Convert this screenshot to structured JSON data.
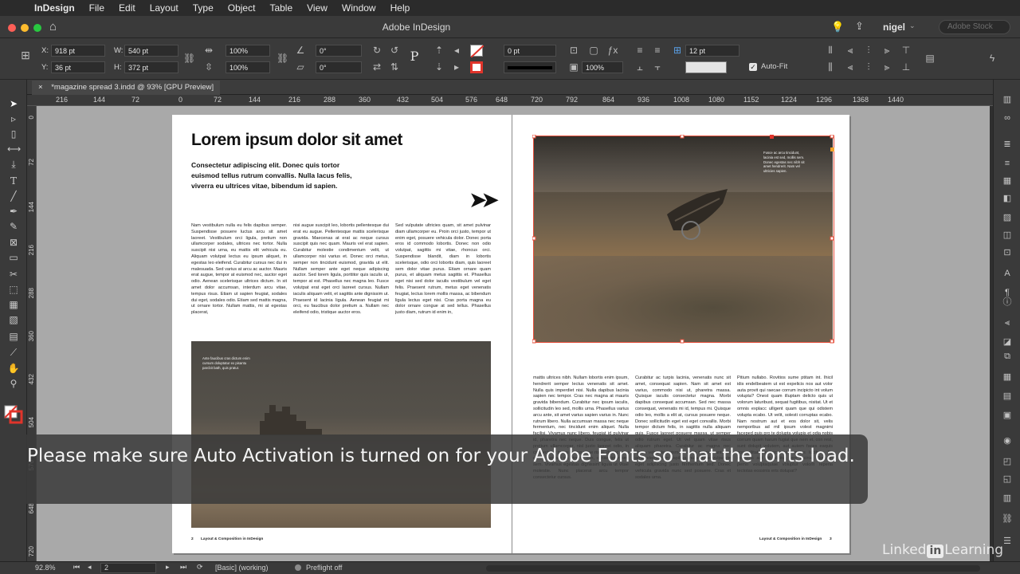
{
  "menubar": {
    "app_name": "InDesign",
    "items": [
      "File",
      "Edit",
      "Layout",
      "Type",
      "Object",
      "Table",
      "View",
      "Window",
      "Help"
    ]
  },
  "window": {
    "title": "Adobe InDesign",
    "user": "nigel",
    "stock_search_placeholder": "Adobe Stock"
  },
  "control_panel": {
    "x_label": "X:",
    "x_value": "918 pt",
    "y_label": "Y:",
    "y_value": "36 pt",
    "w_label": "W:",
    "w_value": "540 pt",
    "h_label": "H:",
    "h_value": "372 pt",
    "scale_x": "100%",
    "scale_y": "100%",
    "rotate": "0°",
    "shear": "0°",
    "stroke_weight": "0 pt",
    "opacity": "100%",
    "gutter": "12 pt",
    "auto_fit_label": "Auto-Fit",
    "auto_fit_checked": true
  },
  "document_tab": {
    "close": "×",
    "label": "*magazine spread 3.indd @ 93% [GPU Preview]"
  },
  "rulers": {
    "horizontal": [
      "216",
      "144",
      "72",
      "0",
      "72",
      "144",
      "216",
      "288",
      "360",
      "432",
      "504",
      "576",
      "648",
      "720",
      "792",
      "864",
      "936",
      "1008",
      "1080",
      "1152",
      "1224",
      "1296",
      "1368",
      "1440"
    ],
    "vertical": [
      "0",
      "72",
      "144",
      "216",
      "288",
      "360",
      "432",
      "504",
      "576",
      "648",
      "720"
    ]
  },
  "spread": {
    "headline": "Lorem ipsum dolor sit amet",
    "subhead": "Consectetur adipiscing elit. Donec quis tortor euismod tellus rutrum convallis. Nulla lacus felis, viverra eu ultrices vitae, bibendum id sapien.",
    "col1": "Nam vestibulum nulla eu felis dapibus semper. Suspendisse posuere luctus arcu sit amet laoreet. Vestibulum orci ligula, pretium non ullamcorper sodales, ultrices nec tortor. Nulla suscipit nisi urna, eu mattis elit vehicula eu. Aliquam volutpat lectus eu ipsum aliquet, in egestas leo eleifend. Curabitur cursus nec dui in malesuada. Sed varius at arcu ac auctor. Mauris erat augue, tempor at euismod nec, auctor eget odio. Aenean scelerisque ultrices dictum. In sit amet dolor accumsan, interdum arcu vitae, tempus risus. Etiam ut sapien feugiat, sodales dui eget, sodales odio. Etiam sed mattis magna, ut ornare tortor. Nullam mattis, mi at egestas placerat,",
    "col2": "nisi augue suscipit leo, lobortis pellentesque dui erat eu augue. Pellentesque mattis scelerisque gravida. Maecenas at erat ac neque cursus suscipit quis nec quam. Mauris vel erat sapien. Curabitur molestie condimentum velit, ut ullamcorper nisi varius et. Donec orci metus, semper non tincidunt euismod, gravida ut elit. Nullam semper ante eget neque adipiscing auctor. Sed lorem ligula, porttitor quis iaculis ut, tempor at est. Phasellus nec magna leo. Fusce volutpat erat eget orci laoreet cursus. Nullam iaculis aliquam velit, et sagittis ante dignissim ut. Praesent id lacinia ligula. Aenean feugiat mi orci, eu faucibus dolor pretium a. Nullam nec eleifend odio, tristique auctor eros.",
    "col3": "Sed vulputate ultricies quam, sit amet pulvinar diam ullamcorper eu. Proin orci justo, tempor ut enim eget, posuere vehicula dolor. Donec porta eros id commodo lobortis. Donec non odio volutpat, sagittis mi vitae, rhoncus orci. Suspendisse blandit, diam in lobortis scelerisque, odio orci lobortis diam, quis laoreet sem dolor vitae purus. Etiam ornare quam purus, et aliquam metus sagittis et. Phasellus eget nisi sed dolor iaculis vestibulum vel eget felis. Praesent rutrum, metus eget venenatis feugiat, lectus lorem mollis massa, ac bibendum ligula lectus eget nisi. Cras porta magna eu dolor ornare congue at sed tellus. Phasellus justo diam, rutrum id enim in,",
    "img_left_caption": "Ante faucibus cras dictum enim cursum doluptatur ex pisantu parcbit bath, quis pratur.",
    "img_right_caption": "Fusce ac arcu tincidunt, lacinia est sed, mollis sem. Donec egestas nec nibh sit amet hendrerit. Nam vel ultricies sapien.",
    "rcol1": "mattis ultrices nibh. Nullam lobortis enim ipsum, hendrerit semper lectus venenatis sit amet. Nulla quis imperdiet nisi. Nulla dapibus lacinia sapien nec tempor. Cras nec magna at mauris gravida bibendum. Curabitur nec ipsum iaculis, sollicitudin leo sed, mollis urna. Phasellus varius arcu ante, sit amet varius sapien varius in. Nunc rutrum libero. Nulla accumsan massa nec neque fermentum, nec tincidunt enim aliquet. Nulla facilisi. Vivamus nunc libero, feugiat id pulvinar id, pharetra nec neque. Duis congue, felis ut pretium ullamcorper, nisl justo laoreet odio, in consectetur purus metus vitae risus. donec arcu enim, dapibus eu viverra non, consectetur sed sem. Vivamus egestas dignissim ligula ut vitae molestie. Nunc placerat arcu tempor consectetur cursus.",
    "rcol2": "Curabitur ac turpis lacinia, venenatis nunc sit amet, consequat sapien. Nam sit amet est varius, commodo nisi ut, pharetra massa. Quisque iaculis consectetur magna. Morbi dapibus consequat accumsan. Sed nec massa consequat, venenatis mi id, tempus mi. Quisque odio leo, mollis a elit at, cursus posuere neque. Donec sollicitudin eget est eget convallis. Morbi tempor dictum felis, in sagittis nulla aliquam quis. Fusce laoreet posuere massa, ut semper odio rutrum eget. Ut vel quam vitae risus aliquam pharetra. Curabitur ac magna nec libero vehicula euismod. Nam tempor, ante sit amet elementum dapibus, nulla tellus vulputate eget adipiscing justo fermentum sed. Donec vehicula gravida nunc sed posuere. Cras et sodales urna.",
    "rcol3": "Pitium nullabo. Rovitios sume ptitam int. Ihicil idis endelbeatem ut est expelicis nos aut volor auta provit qui raecae corrum incipicto int volum volupta? Onest quam illuptam delicto quis ut volorum laturibust, sequat fugitibus, nisitat. Ut et omnis explacc ulligent quam que qui odistem volupta ecabo. Ut velit, solesti corruptas ecabo. Nam nostrum aut et eos dolor sit, velis nemporibus ad mil ipsum volest magnimi faceped quis pro te dolupta volupis et odia nobis corrum quam harum fugiat que nem et, con rest, sunt dolupit volutem, aut autem faces eaquis eos ullitatibus accumsan mattis lucibus. Es conseris aut lab dicitur, tem lacinia ullam et pemo voluptaquiae voluptur volorit reperia tectotas eossinis eris dolupat?",
    "footer_left_num": "2",
    "footer_left": "Layout & Composition in InDesign",
    "footer_right": "Layout & Composition in InDesign",
    "footer_right_num": "3"
  },
  "status_bar": {
    "zoom": "92.8%",
    "page": "2",
    "style": "[Basic] (working)",
    "preflight": "Preflight off"
  },
  "caption": "Please make sure Auto Activation is turned on for your Adobe Fonts so that the fonts load.",
  "watermark": {
    "pre": "Linked",
    "in": "in",
    "post": "Learning"
  },
  "colors": {
    "accent_red": "#e0342b",
    "selection_frame": "#e64e3a",
    "frame_handle": "#f2a22a"
  },
  "tool_icons": [
    "selection-icon",
    "direct-selection-icon",
    "page-icon",
    "gap-icon",
    "content-collector-icon",
    "type-icon",
    "line-icon",
    "pen-icon",
    "pencil-icon",
    "rectangle-frame-icon",
    "rectangle-icon",
    "scissors-icon",
    "free-transform-icon",
    "gradient-icon",
    "gradient-feather-icon",
    "note-icon",
    "eyedropper-icon",
    "hand-icon",
    "zoom-icon",
    "fill-stroke-icon"
  ]
}
